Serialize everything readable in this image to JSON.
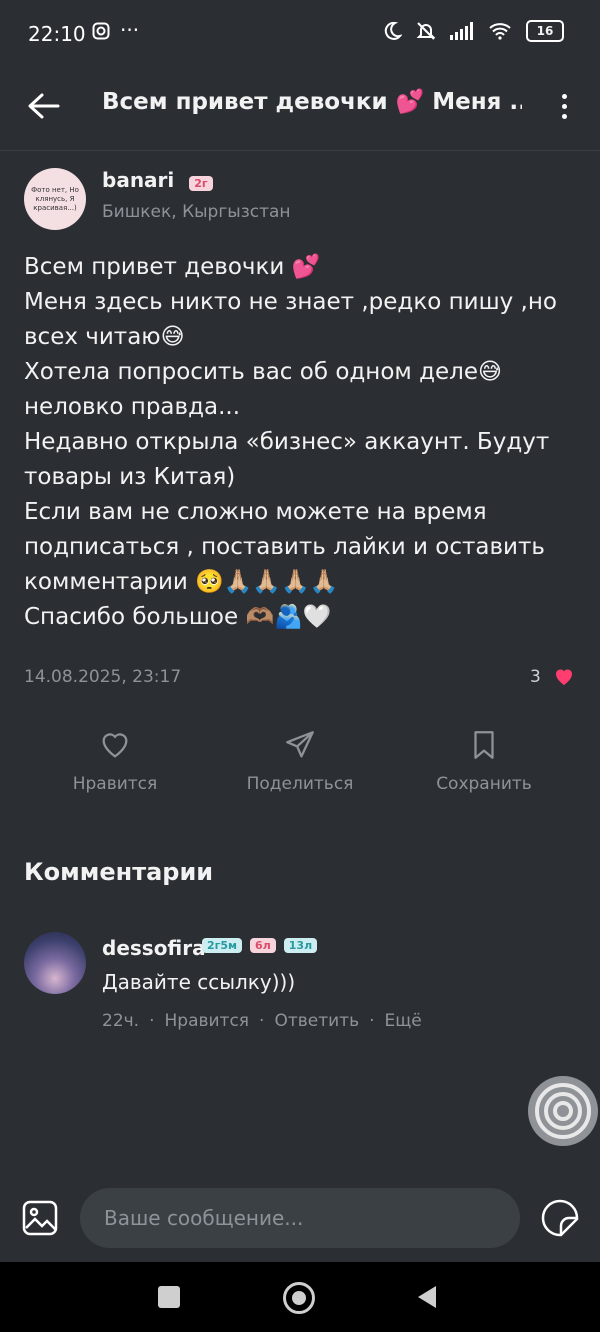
{
  "status_bar": {
    "time": "22:10",
    "battery": "16"
  },
  "header": {
    "title": "Всем привет девочки 💕 Меня ..."
  },
  "author": {
    "name": "banari",
    "badge": "2г",
    "location": "Бишкек, Кыргызстан",
    "avatar_text": "Фото нет, Но клянусь, Я красивая...)"
  },
  "post": {
    "lines": [
      "Всем привет девочки 💕",
      "Меня здесь никто не знает ,редко пишу ,но",
      "всех читаю😅",
      "Хотела попросить вас об одном деле😅",
      "неловко правда...",
      "Недавно открыла «бизнес» аккаунт. Будут",
      "товары из Китая)",
      "Если вам не сложно можете на время",
      "подписаться , поставить лайки и оставить",
      "комментарии 🥺🙏🏼🙏🏼🙏🏼🙏🏼",
      "Спасибо большое 🫶🏽🫂🤍"
    ],
    "date": "14.08.2025, 23:17",
    "likes": "3"
  },
  "actions": {
    "like": "Нравится",
    "share": "Поделиться",
    "save": "Сохранить"
  },
  "comments": {
    "title": "Комментарии",
    "items": [
      {
        "name": "dessofira",
        "badges": [
          "2г5м",
          "6л",
          "13л"
        ],
        "text": "Давайте ссылку)))",
        "time": "22ч.",
        "like": "Нравится",
        "reply": "Ответить",
        "more": "Ещё"
      }
    ]
  },
  "composer": {
    "placeholder": "Ваше сообщение..."
  },
  "colors": {
    "background": "#2b2f33",
    "heart": "#ff3d6e",
    "muted": "#8d9398"
  }
}
